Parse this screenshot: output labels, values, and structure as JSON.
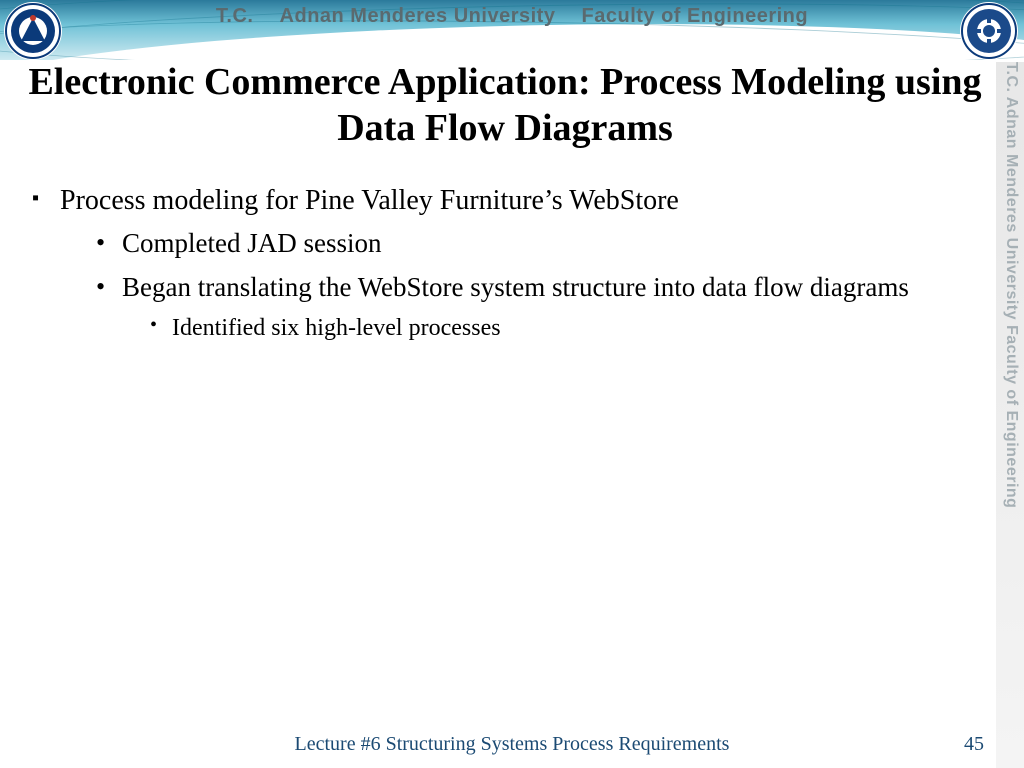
{
  "banner": {
    "tc": "T.C.",
    "university": "Adnan Menderes University",
    "faculty": "Faculty of Engineering"
  },
  "side": {
    "text": "T.C.    Adnan Menderes University    Faculty of Engineering"
  },
  "title": "Electronic Commerce Application: Process Modeling using Data Flow Diagrams",
  "bullets": {
    "l1": "Process modeling for Pine Valley Furniture’s WebStore",
    "l2a": "Completed JAD session",
    "l2b": "Began translating the WebStore system structure into data flow diagrams",
    "l3a": "Identified six high-level processes"
  },
  "footer": {
    "lecture": "Lecture #6 Structuring Systems Process Requirements",
    "page": "45"
  }
}
